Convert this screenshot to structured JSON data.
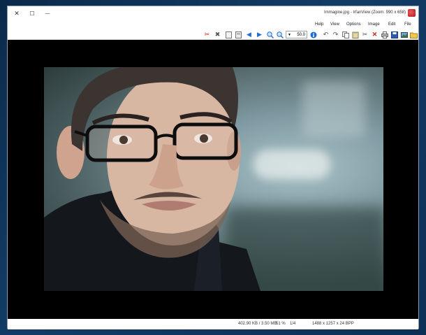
{
  "window": {
    "title": "Immagine.jpg - IrfanView (Zoom: 990 x 658)",
    "controls": {
      "close": "✕",
      "maximize": "☐",
      "minimize": "—"
    }
  },
  "menu": [
    {
      "label": "File"
    },
    {
      "label": "Edit"
    },
    {
      "label": "Image"
    },
    {
      "label": "Options"
    },
    {
      "label": "View"
    },
    {
      "label": "Help"
    }
  ],
  "toolbar": {
    "zoom_value": "50.0",
    "icons": [
      "scissors-red-icon",
      "tools-icon",
      "page-icon",
      "page-copy-icon",
      "arrow-left-icon",
      "arrow-right-icon",
      "zoom-out-icon",
      "zoom-in-icon",
      "info-icon",
      "rotate-left-icon",
      "rotate-right-icon",
      "copy-icon",
      "paste-icon",
      "cut-icon",
      "delete-icon",
      "print-icon",
      "save-icon",
      "slideshow-icon",
      "open-icon"
    ]
  },
  "status": {
    "dimensions": "1488 x 1257 x 24 BPP",
    "index": "1/4",
    "zoom": "51 %",
    "file_info": "402.90 KB / 3.50 MB"
  },
  "colors": {
    "viewer_background": "#000000",
    "desktop": "#123c66"
  }
}
